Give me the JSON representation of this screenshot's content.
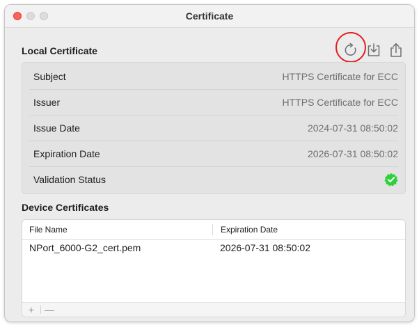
{
  "window": {
    "title": "Certificate"
  },
  "local": {
    "title": "Local Certificate",
    "rows": [
      {
        "label": "Subject",
        "value": "HTTPS Certificate for ECC"
      },
      {
        "label": "Issuer",
        "value": "HTTPS Certificate for ECC"
      },
      {
        "label": "Issue Date",
        "value": "2024-07-31 08:50:02"
      },
      {
        "label": "Expiration Date",
        "value": "2026-07-31 08:50:02"
      },
      {
        "label": "Validation Status",
        "status": "valid"
      }
    ]
  },
  "toolbar": {
    "icons": [
      "refresh-icon",
      "download-icon",
      "share-icon"
    ],
    "highlighted": "refresh-icon",
    "highlight_color": "#e11d1d"
  },
  "device": {
    "title": "Device Certificates",
    "columns": [
      "File Name",
      "Expiration Date"
    ],
    "rows": [
      {
        "file_name": "NPort_6000-G2_cert.pem",
        "expiration": "2026-07-31 08:50:02"
      }
    ],
    "footer": {
      "add": "+",
      "remove": "—"
    }
  },
  "colors": {
    "valid_badge": "#2fd13a",
    "close_button": "#fe5f57"
  }
}
